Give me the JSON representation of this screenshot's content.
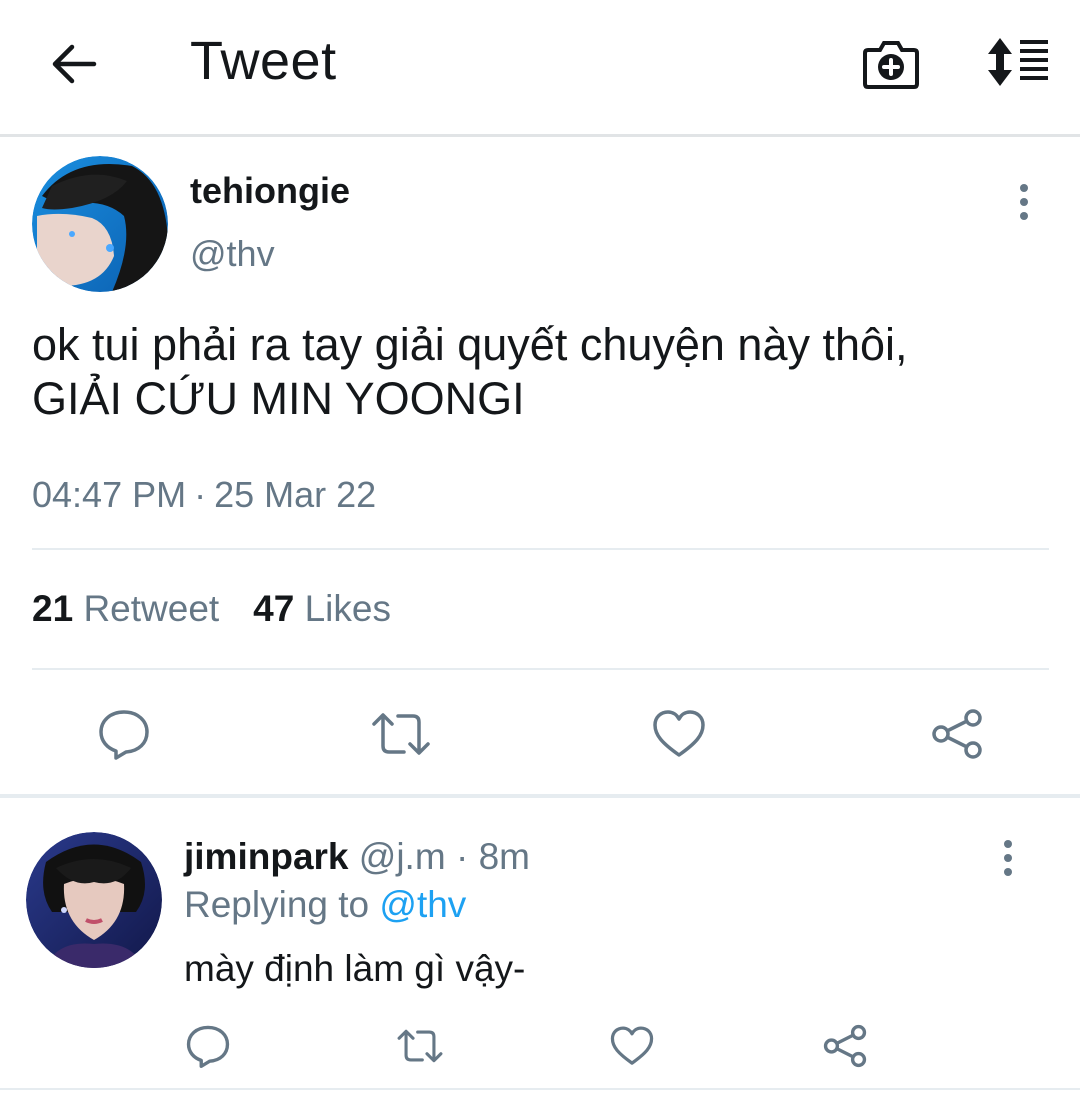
{
  "header": {
    "title": "Tweet",
    "back_icon": "arrow-left-icon",
    "camera_icon": "camera-plus-icon",
    "sort_icon": "sort-list-icon"
  },
  "tweet": {
    "display_name": "tehiongie",
    "handle": "@thv",
    "text_line1": "ok tui phải ra tay giải quyết chuyện này thôi,",
    "text_line2": "GIẢI CỨU MIN YOONGI",
    "time": "04:47 PM",
    "separator": "·",
    "date": "25 Mar 22",
    "retweet_count": "21",
    "retweet_label": "Retweet",
    "like_count": "47",
    "like_label": "Likes",
    "actions": [
      "reply-icon",
      "retweet-icon",
      "heart-icon",
      "share-icon"
    ]
  },
  "reply": {
    "display_name": "jiminpark",
    "handle": "@j.m",
    "separator": "·",
    "time_ago": "8m",
    "replying_prefix": "Replying to",
    "replying_to": "@thv",
    "text": "mày định làm gì vậy-"
  },
  "colors": {
    "text_primary": "#14171a",
    "text_secondary": "#657786",
    "accent": "#1da1f2",
    "divider": "#e6ecf0"
  }
}
